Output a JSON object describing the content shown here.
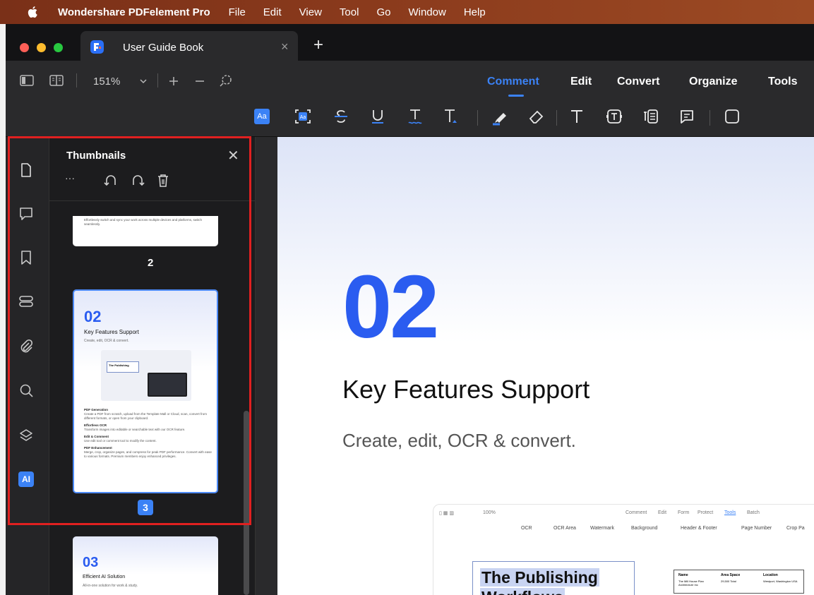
{
  "menubar": {
    "app_name": "Wondershare PDFelement Pro",
    "items": [
      "File",
      "Edit",
      "View",
      "Tool",
      "Go",
      "Window",
      "Help"
    ]
  },
  "tab": {
    "title": "User Guide Book",
    "close_glyph": "×",
    "new_tab_glyph": "+"
  },
  "toolbar": {
    "zoom": "151%",
    "nav_tabs": [
      "Comment",
      "Edit",
      "Convert",
      "Organize",
      "Tools"
    ],
    "active_tab": "Comment",
    "tools": [
      "highlight-text-icon",
      "area-highlight-icon",
      "strikethrough-icon",
      "underline-icon",
      "squiggly-icon",
      "insert-text-icon",
      "marker-icon",
      "eraser-icon",
      "text-icon",
      "textbox-icon",
      "callout-icon",
      "note-icon",
      "shape-icon"
    ],
    "aa_label": "Aa",
    "accent": "#3b82f6"
  },
  "rail": {
    "items": [
      "page-icon",
      "comment-icon",
      "bookmark-icon",
      "fields-icon",
      "attachment-icon",
      "search-icon",
      "layers-icon",
      "ai-icon"
    ],
    "ai_label": "AI"
  },
  "thumbnails": {
    "title": "Thumbnails",
    "more_glyph": "···",
    "pages": [
      {
        "number": "2",
        "snippet": "Effortlessly switch and sync your work across multiple devices and platforms, switch seamlessly."
      },
      {
        "number": "3",
        "big": "02",
        "heading": "Key Features Support",
        "sub": "Create, edit, OCR & convert.",
        "sections": [
          {
            "title": "PDF Generation",
            "body": "Create a PDF from scratch, upload from the Template Mall or Cloud, scan, convert from different formats, or open from your clipboard."
          },
          {
            "title": "Effortless OCR",
            "body": "Transform images into editable or searchable text with our OCR feature."
          },
          {
            "title": "Edit & Comment",
            "body": "Use edit tool or comment tool to modify the content."
          },
          {
            "title": "PDF Enhancement",
            "body": "Merge, crop, organize pages, and compress for peak PDF performance. Convert with ease to various formats. Premium members enjoy enhanced privileges."
          }
        ]
      },
      {
        "big": "03",
        "heading": "Efficient AI Solution",
        "sub": "All-in-one solution for work & study."
      }
    ]
  },
  "document": {
    "big_number": "02",
    "heading": "Key Features Support",
    "subheading": "Create, edit, OCR & convert.",
    "inner": {
      "zoom": "100%",
      "tabs": [
        "Comment",
        "Edit",
        "Form",
        "Protect",
        "Tools",
        "Batch"
      ],
      "tools": [
        "OCR",
        "OCR Area",
        "Watermark",
        "Background",
        "Header & Footer",
        "Page Number",
        "Crop Pa"
      ],
      "box_line1": "The Publishing",
      "box_line2": "Workflows",
      "table_headers": [
        "Name",
        "Area Space",
        "Location"
      ],
      "table_row": [
        "The Mill House Plan Architecture Inc",
        "29,500 Total",
        "Westport, Washington USA"
      ]
    }
  }
}
